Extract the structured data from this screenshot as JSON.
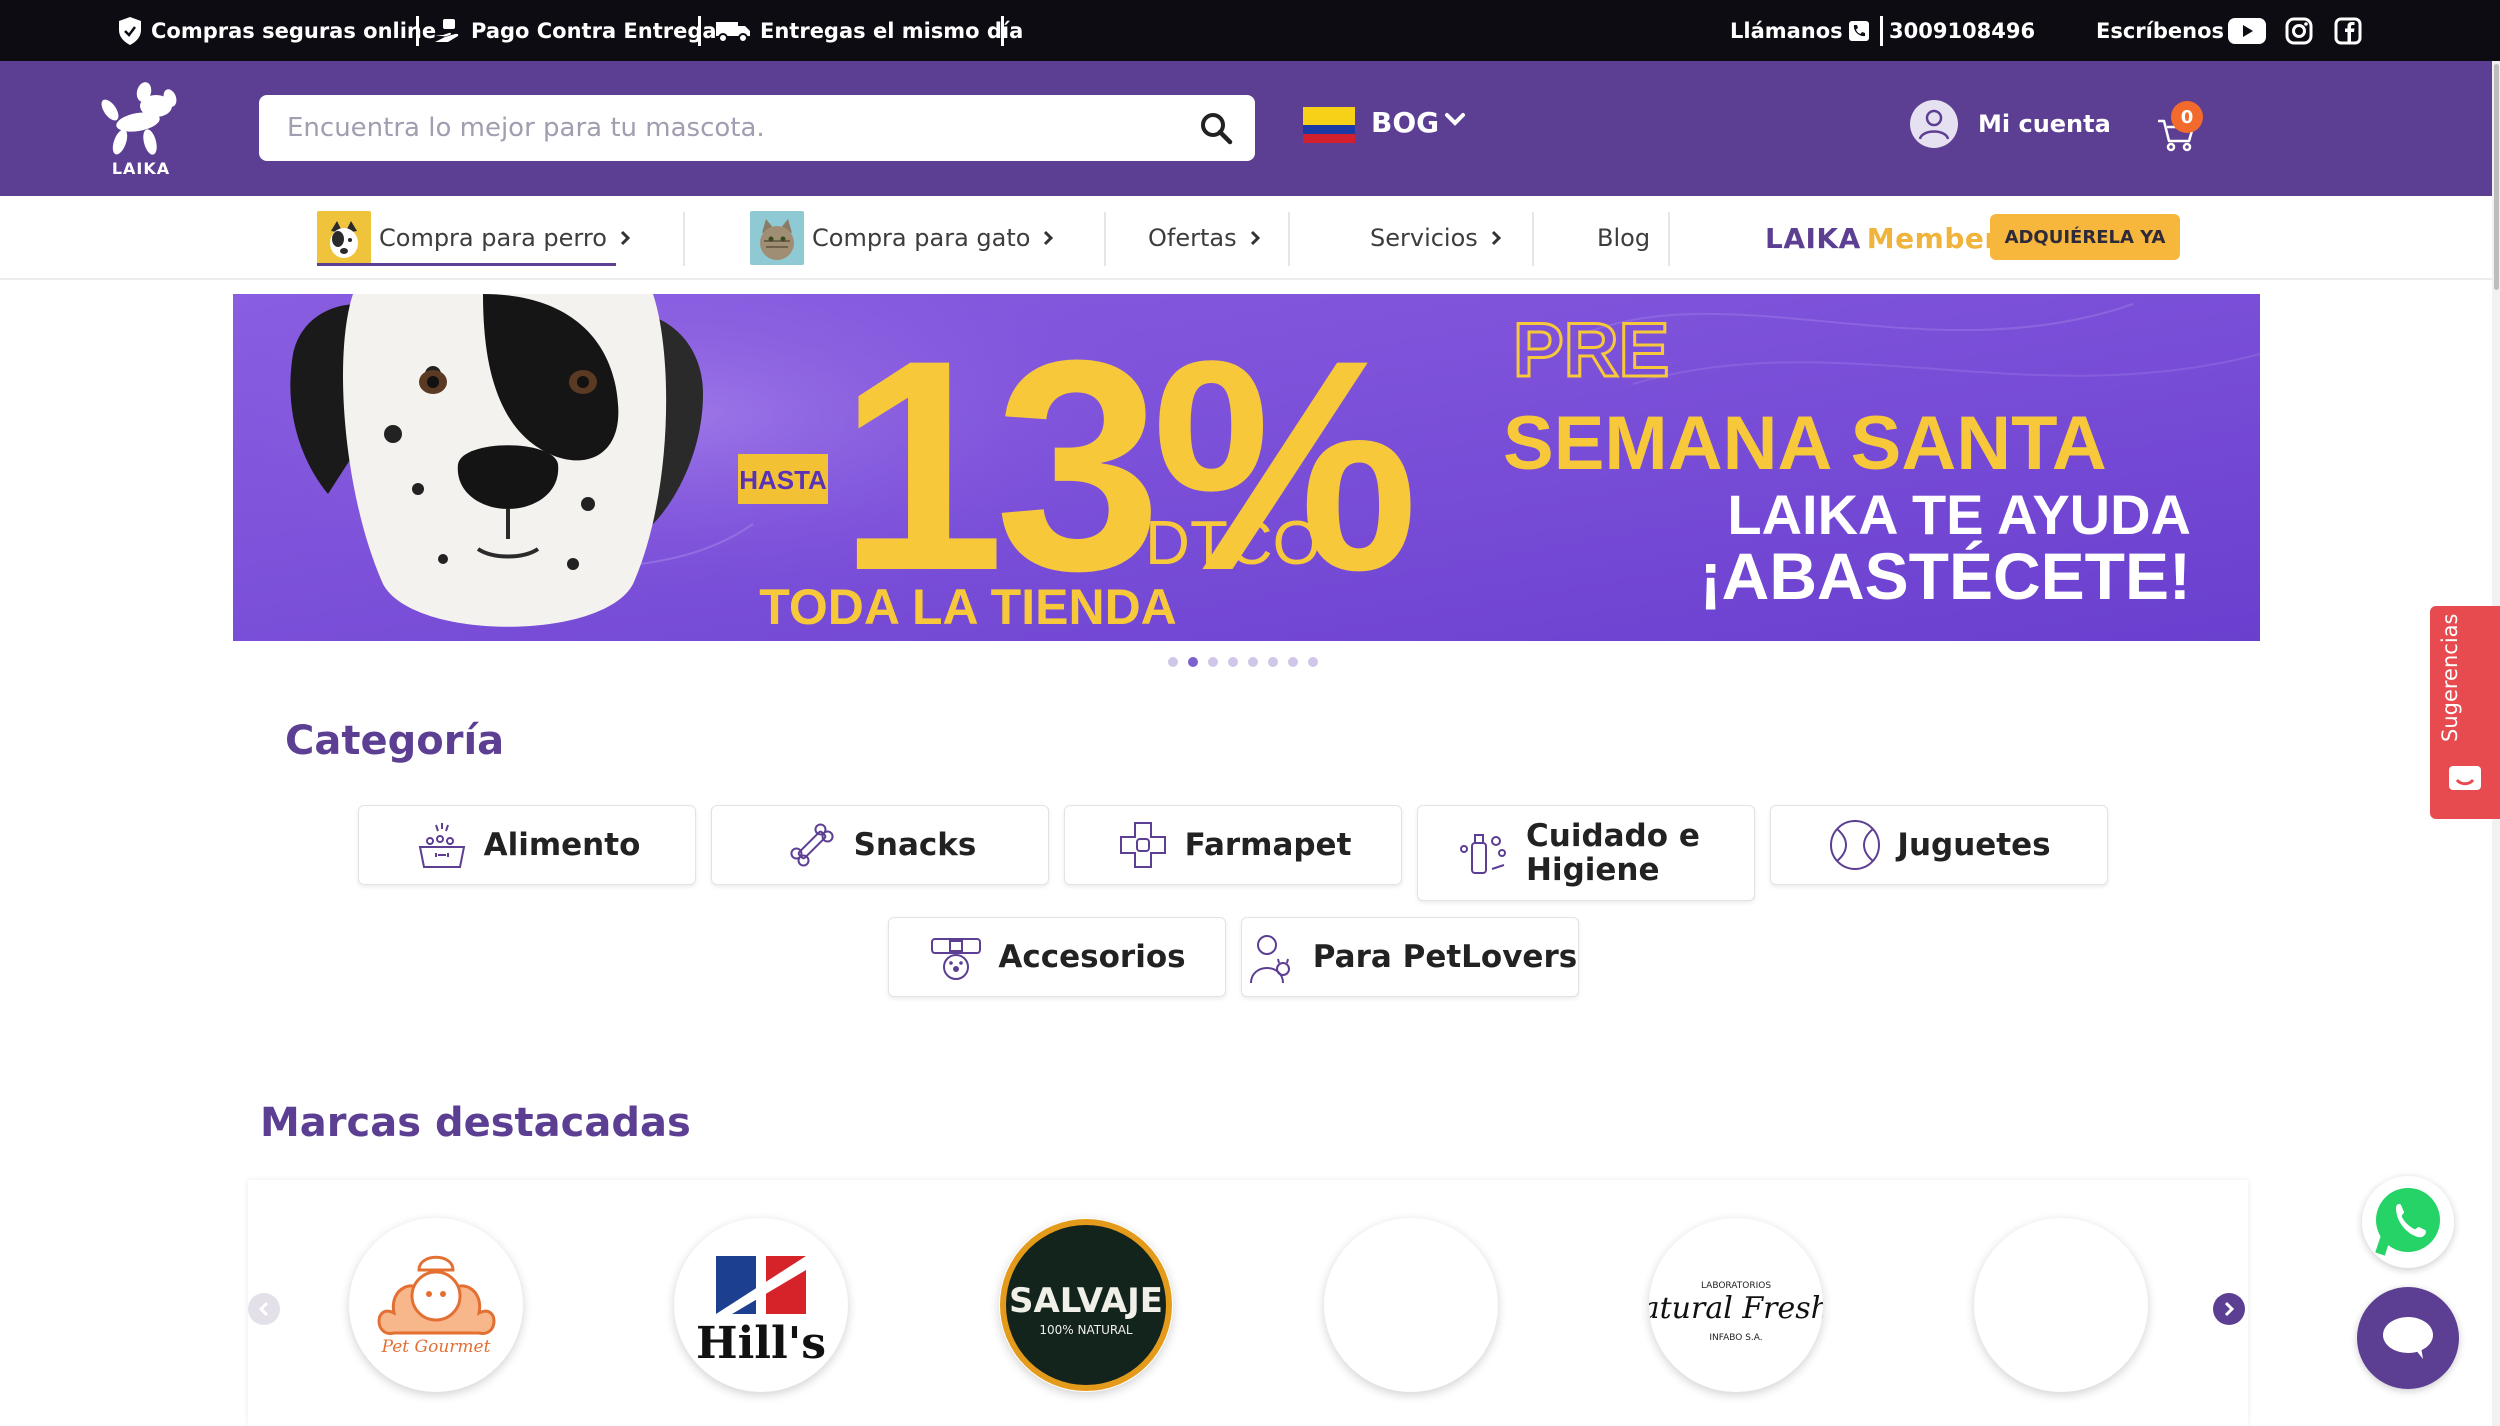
{
  "topbar": {
    "secure": "Compras seguras online",
    "cod": "Pago Contra Entrega",
    "delivery": "Entregas el mismo día",
    "call_label": "Llámanos",
    "phone": "3009108496",
    "write_label": "Escríbenos"
  },
  "header": {
    "logo_text": "LAIKA",
    "search_placeholder": "Encuentra lo mejor para tu mascota.",
    "city": "BOG",
    "account_label": "Mi cuenta",
    "cart_count": "0"
  },
  "nav": {
    "dog": "Compra para perro",
    "cat": "Compra para gato",
    "offers": "Ofertas",
    "services": "Servicios",
    "blog": "Blog",
    "member_brand": "LAIKA",
    "member_word": "Member",
    "member_button": "ADQUIÉRELA YA"
  },
  "banner": {
    "hasta": "HASTA",
    "percent": "13%",
    "dtco": "DTCO",
    "store": "TODA LA TIENDA",
    "pre": "PRE",
    "semana": "SEMANA SANTA",
    "ayuda": "LAIKA TE AYUDA",
    "abastecete": "¡ABASTÉCETE!",
    "slide_count": 8,
    "active_slide": 2
  },
  "categories": {
    "title": "Categoría",
    "items": [
      "Alimento",
      "Snacks",
      "Farmapet",
      "Cuidado e Higiene",
      "Juguetes",
      "Accesorios",
      "Para PetLovers"
    ]
  },
  "brands": {
    "title": "Marcas destacadas",
    "logo_texts": [
      "Pet Gourmet",
      "Hill's",
      "SALVAJE",
      "100% NATURAL",
      "Natural Freshly",
      "LABORATORIOS",
      "INFABO S.A."
    ]
  },
  "floating": {
    "suggestions": "Sugerencias"
  },
  "colors": {
    "brand_purple": "#5c3f93",
    "accent_yellow": "#f6b73c",
    "badge_orange": "#f26b2c",
    "suggest_red": "#e84b4f",
    "whatsapp_green": "#25d366"
  }
}
